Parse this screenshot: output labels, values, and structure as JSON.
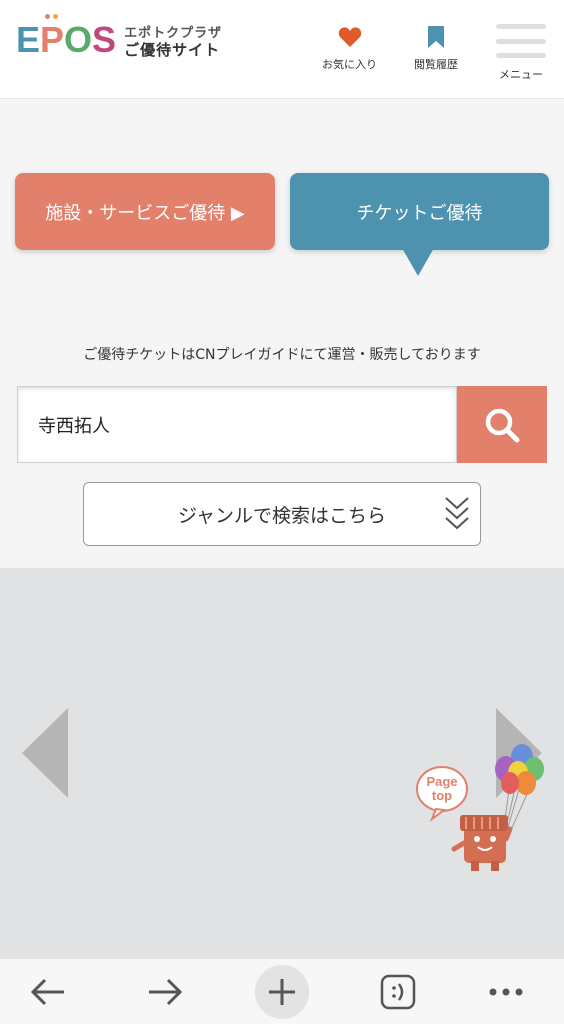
{
  "header": {
    "logo_letters": [
      "E",
      "P",
      "O",
      "S"
    ],
    "logo_sub1": "エポトクプラザ",
    "logo_sub2": "ご優待サイト",
    "favorites_label": "お気に入り",
    "history_label": "閲覧履歴",
    "menu_label": "メニュー"
  },
  "tabs": {
    "facility_label": "施設・サービスご優待 ▶",
    "ticket_label": "チケットご優待"
  },
  "notice": "ご優待チケットはCNプレイガイドにて運営・販売しております",
  "search": {
    "value": "寺西拓人"
  },
  "genre_button_label": "ジャンルで検索はこちら",
  "pagetop": {
    "line1": "Page",
    "line2": "top"
  },
  "colors": {
    "facility_tab": "#e2806b",
    "ticket_tab": "#4d93b0",
    "search_button": "#e2806b",
    "heart": "#e05a2b",
    "bookmark": "#4d93b0",
    "carousel_bg": "#e0e2e3"
  },
  "icons": {
    "favorites": "heart-icon",
    "history": "bookmark-icon",
    "menu": "hamburger-icon",
    "search": "magnifier-icon",
    "genre": "double-chevron-down-icon",
    "carousel_prev": "triangle-left-icon",
    "carousel_next": "triangle-right-icon",
    "browser_back": "arrow-left-icon",
    "browser_forward": "arrow-right-icon",
    "browser_new_tab": "plus-icon",
    "browser_tabs": "tabs-face-icon",
    "browser_more": "more-dots-icon"
  }
}
